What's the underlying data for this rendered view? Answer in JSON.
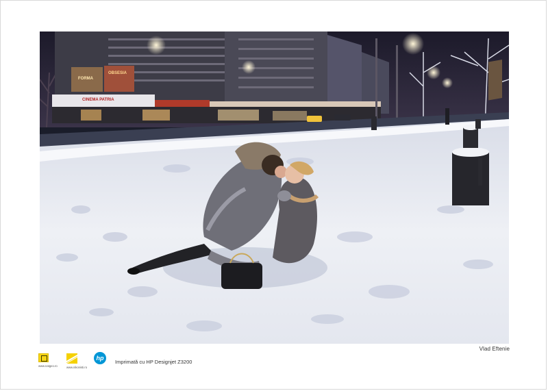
{
  "photo": {
    "subject": "Couple kissing in the snow on a city boulevard at night",
    "storefront_signs": [
      "CINEMA PATRIA",
      "FORMA",
      "OBSESIA"
    ],
    "colors": {
      "night_sky": "#2a2438",
      "snow": "#eef0f5",
      "snow_shadow": "#c9cede",
      "building": "#3b3a44",
      "street_light": "#fff6d8"
    }
  },
  "credit": "Vlad Eftenie",
  "footer": {
    "printed_with": "Imprimată cu HP Designjet Z3200",
    "logos": [
      {
        "icon": "national-geographic-icon",
        "url": "www.natgeo.ro"
      },
      {
        "icon": "nikon-icon",
        "url": "www.nikonisti.ro"
      },
      {
        "icon": "hp-icon",
        "text": "hp"
      }
    ]
  }
}
